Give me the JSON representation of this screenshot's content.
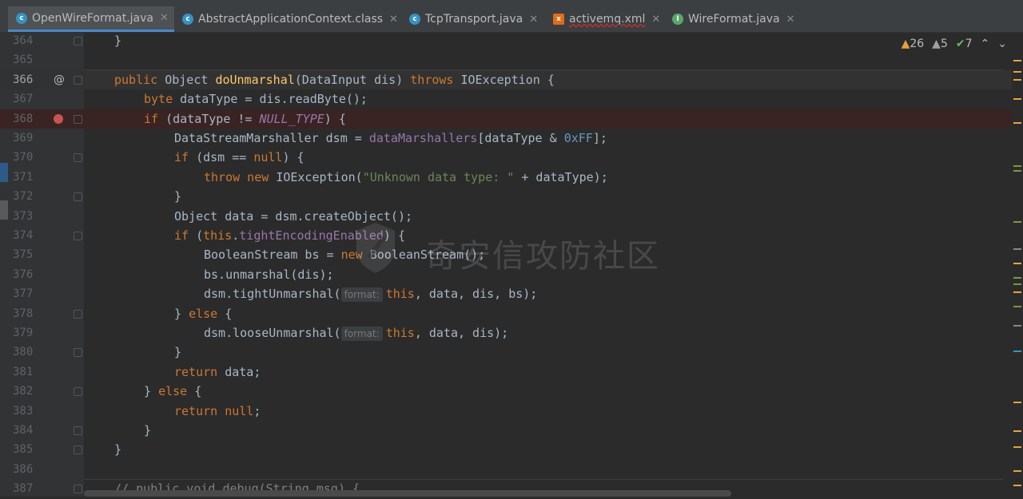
{
  "tabs": [
    {
      "label": "OpenWireFormat.java",
      "icon": "class-icon",
      "color": "#3592c4",
      "active": true
    },
    {
      "label": "AbstractApplicationContext.class",
      "icon": "class-file-icon",
      "color": "#3592c4",
      "active": false
    },
    {
      "label": "TcpTransport.java",
      "icon": "class-icon",
      "color": "#3592c4",
      "active": false
    },
    {
      "label": "activemq.xml",
      "icon": "xml-file-icon",
      "color": "#e06c1a",
      "active": false
    },
    {
      "label": "WireFormat.java",
      "icon": "interface-icon",
      "color": "#59a869",
      "active": false
    }
  ],
  "inspections": {
    "warnings": "26",
    "weak_warnings": "5",
    "typos": "7"
  },
  "watermark": "奇安信攻防社区",
  "lines": [
    {
      "n": "364"
    },
    {
      "n": "365"
    },
    {
      "n": "366"
    },
    {
      "n": "367"
    },
    {
      "n": "368"
    },
    {
      "n": "369"
    },
    {
      "n": "370"
    },
    {
      "n": "371"
    },
    {
      "n": "372"
    },
    {
      "n": "373"
    },
    {
      "n": "374"
    },
    {
      "n": "375"
    },
    {
      "n": "376"
    },
    {
      "n": "377"
    },
    {
      "n": "378"
    },
    {
      "n": "379"
    },
    {
      "n": "380"
    },
    {
      "n": "381"
    },
    {
      "n": "382"
    },
    {
      "n": "383"
    },
    {
      "n": "384"
    },
    {
      "n": "385"
    },
    {
      "n": "386"
    },
    {
      "n": "387"
    }
  ],
  "code": {
    "l364": "}",
    "l366_a": "public ",
    "l366_b": "Object ",
    "l366_c": "doUnmarshal",
    "l366_d": "(DataInput dis) ",
    "l366_e": "throws ",
    "l366_f": "IOException {",
    "l367_a": "byte ",
    "l367_b": "dataType = dis.readByte();",
    "l368_a": "if ",
    "l368_b": "(dataType != ",
    "l368_c": "NULL_TYPE",
    "l368_d": ") {",
    "l369_a": "DataStreamMarshaller dsm = ",
    "l369_b": "dataMarshallers",
    "l369_c": "[dataType & ",
    "l369_d": "0xFF",
    "l369_e": "];",
    "l370_a": "if ",
    "l370_b": "(dsm == ",
    "l370_c": "null",
    "l370_d": ") {",
    "l371_a": "throw new ",
    "l371_b": "IOException(",
    "l371_c": "\"Unknown data type: \"",
    "l371_d": " + dataType);",
    "l372": "}",
    "l373": "Object data = dsm.createObject();",
    "l374_a": "if ",
    "l374_b": "(",
    "l374_c": "this",
    "l374_d": ".",
    "l374_e": "tightEncodingEnabled",
    "l374_f": ") {",
    "l375_a": "BooleanStream bs = ",
    "l375_b": "new ",
    "l375_c": "BooleanStream();",
    "l376": "bs.unmarshal(dis);",
    "l377_a": "dsm.tightUnmarshal(",
    "l377_hint": "format:",
    "l377_b": "this",
    "l377_c": ", data, dis, bs);",
    "l378_a": "} ",
    "l378_b": "else ",
    "l378_c": "{",
    "l379_a": "dsm.looseUnmarshal(",
    "l379_hint": "format:",
    "l379_b": "this",
    "l379_c": ", data, dis);",
    "l380": "}",
    "l381_a": "return ",
    "l381_b": "data;",
    "l382_a": "} ",
    "l382_b": "else ",
    "l382_c": "{",
    "l383_a": "return ",
    "l383_b": "null",
    "l383_c": ";",
    "l384": "}",
    "l385": "}",
    "l387": "// public void debug(String msg) {"
  }
}
